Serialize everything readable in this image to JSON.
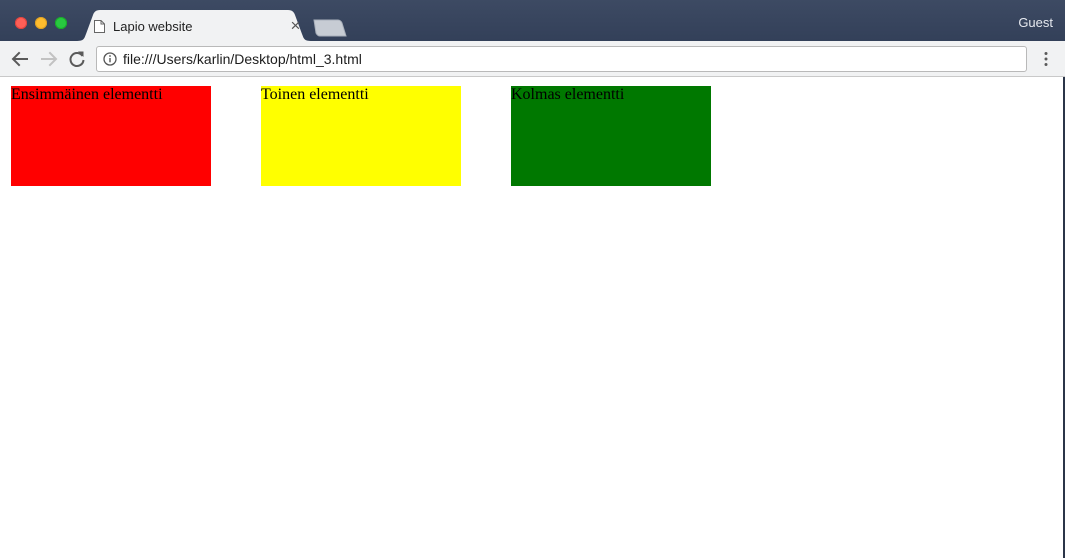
{
  "browser": {
    "tab": {
      "title": "Lapio website",
      "close_glyph": "×",
      "icon": "document-icon"
    },
    "profile_label": "Guest",
    "address_bar": {
      "url": "file:///Users/karlin/Desktop/html_3.html",
      "icon": "info-icon"
    },
    "nav": {
      "back_icon": "back-arrow-icon",
      "forward_icon": "forward-arrow-icon",
      "reload_icon": "reload-icon",
      "menu_icon": "kebab-menu-icon"
    }
  },
  "page": {
    "elements": [
      {
        "label": "Ensimmäinen elementti",
        "color": "#ff0000"
      },
      {
        "label": "Toinen elementti",
        "color": "#ffff00"
      },
      {
        "label": "Kolmas elementti",
        "color": "#007800"
      }
    ]
  }
}
